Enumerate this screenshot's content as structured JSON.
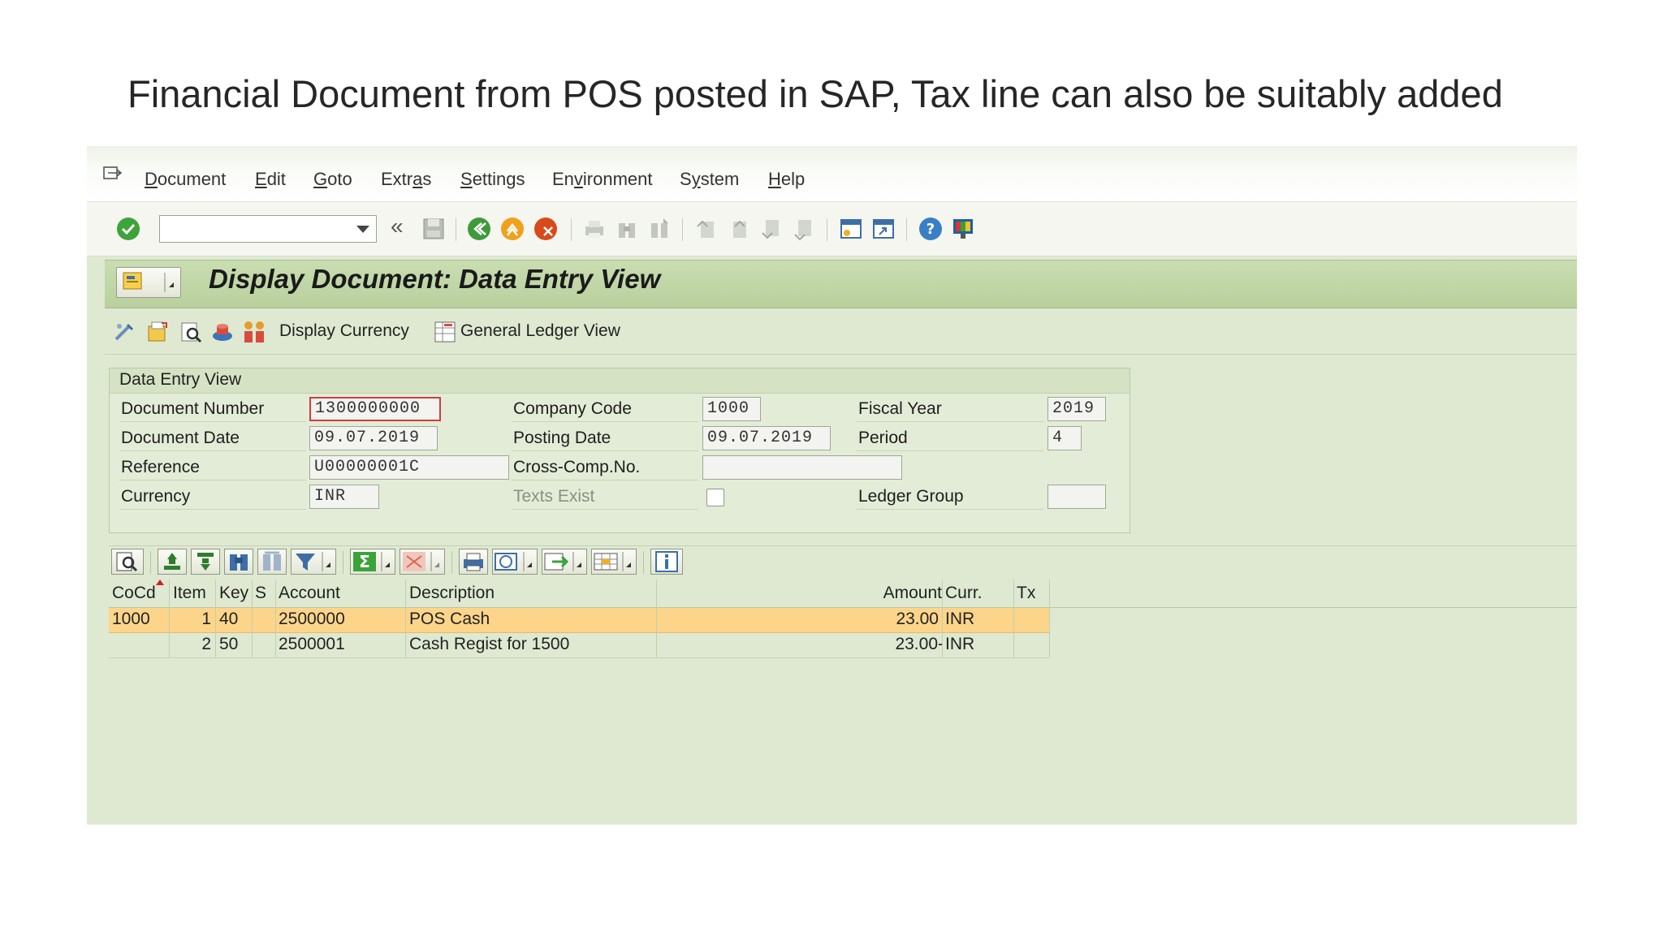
{
  "slide_title": "Financial Document from POS posted in SAP, Tax line can also be suitably added",
  "menu": [
    {
      "pre": "",
      "u": "D",
      "post": "ocument"
    },
    {
      "pre": "",
      "u": "E",
      "post": "dit"
    },
    {
      "pre": "",
      "u": "G",
      "post": "oto"
    },
    {
      "pre": "Extr",
      "u": "a",
      "post": "s"
    },
    {
      "pre": "",
      "u": "S",
      "post": "ettings"
    },
    {
      "pre": "En",
      "u": "v",
      "post": "ironment"
    },
    {
      "pre": "S",
      "u": "y",
      "post": "stem"
    },
    {
      "pre": "",
      "u": "H",
      "post": "elp"
    }
  ],
  "toolbar": {
    "command_field_value": "",
    "double_left_glyph": "«"
  },
  "title": "Display Document: Data Entry View",
  "app_toolbar": {
    "display_currency": "Display Currency",
    "general_ledger_view": "General Ledger View"
  },
  "group": {
    "title": "Data Entry View",
    "document_number_label": "Document Number",
    "document_number": "1300000000",
    "company_code_label": "Company Code",
    "company_code": "1000",
    "fiscal_year_label": "Fiscal Year",
    "fiscal_year": "2019",
    "document_date_label": "Document Date",
    "document_date": "09.07.2019",
    "posting_date_label": "Posting Date",
    "posting_date": "09.07.2019",
    "period_label": "Period",
    "period": "4",
    "reference_label": "Reference",
    "reference": "U00000001C",
    "cross_comp_label": "Cross-Comp.No.",
    "cross_comp": "",
    "currency_label": "Currency",
    "currency": "INR",
    "texts_exist_label": "Texts Exist",
    "texts_exist": false,
    "ledger_group_label": "Ledger Group",
    "ledger_group": ""
  },
  "table": {
    "headers": {
      "cocd": "CoCd",
      "item": "Item",
      "key": "Key",
      "s": "S",
      "account": "Account",
      "description": "Description",
      "amount": "Amount",
      "curr": "Curr.",
      "tx": "Tx"
    },
    "rows": [
      {
        "cocd": "1000",
        "item": "1",
        "key": "40",
        "s": "",
        "account": "2500000",
        "description": "POS Cash",
        "amount": "23.00",
        "curr": "INR",
        "tx": ""
      },
      {
        "cocd": "",
        "item": "2",
        "key": "50",
        "s": "",
        "account": "2500001",
        "description": "Cash Regist for 1500",
        "amount": "23.00-",
        "curr": "INR",
        "tx": ""
      }
    ]
  },
  "colors": {
    "accent_green": "#bcd3a0",
    "selected_row": "#fcd58b",
    "focus_border": "#d23c3c"
  }
}
